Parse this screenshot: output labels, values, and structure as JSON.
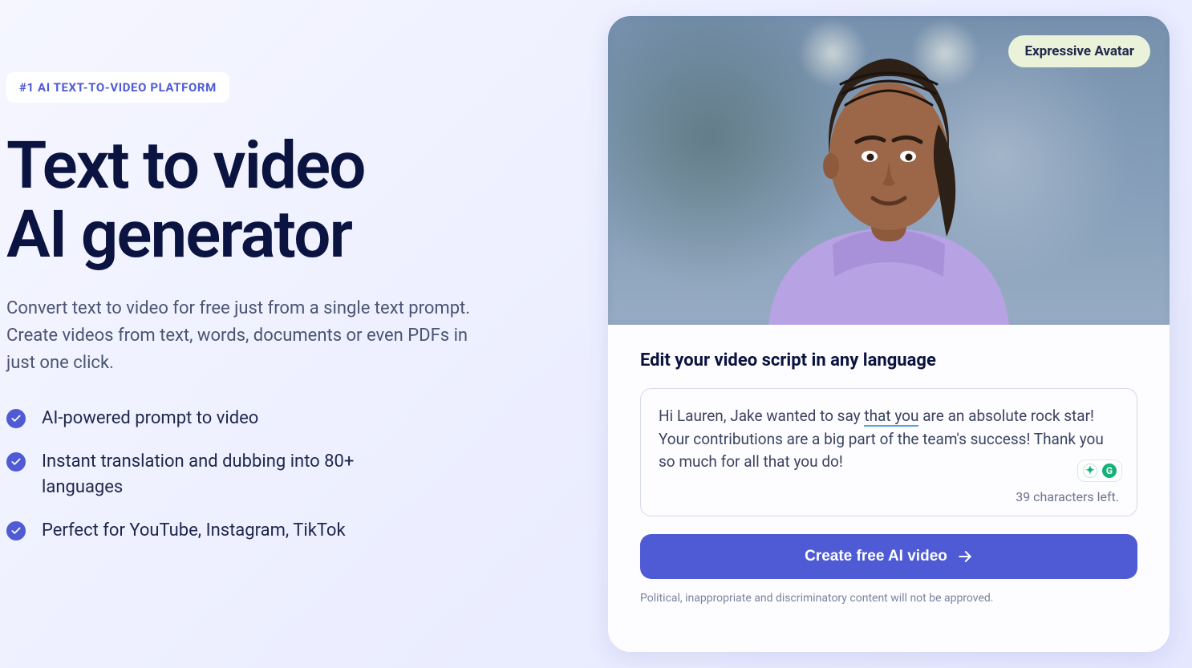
{
  "hero": {
    "badge": "#1 AI TEXT-TO-VIDEO PLATFORM",
    "headline_line1": "Text to video",
    "headline_line2": "AI generator",
    "subhead": "Convert text to video for free just from a single text prompt. Create videos from text, words, documents or even PDFs in just one click.",
    "features": [
      "AI-powered prompt to video",
      "Instant translation and dubbing into 80+ languages",
      "Perfect for YouTube, Instagram, TikTok"
    ]
  },
  "card": {
    "avatar_tag": "Expressive Avatar",
    "editor_title": "Edit your video script in any language",
    "script_prefix": "Hi Lauren, Jake wanted to say ",
    "script_marked": "that you",
    "script_suffix": " are an absolute rock star! Your contributions are a big part of the team's success! Thank you so much for all that you do!",
    "characters_left": "39 characters left.",
    "cta_label": "Create free AI video",
    "disclaimer": "Political, inappropriate and discriminatory content will not be approved.",
    "grammarly_plus": "✦",
    "grammarly_g": "G"
  }
}
